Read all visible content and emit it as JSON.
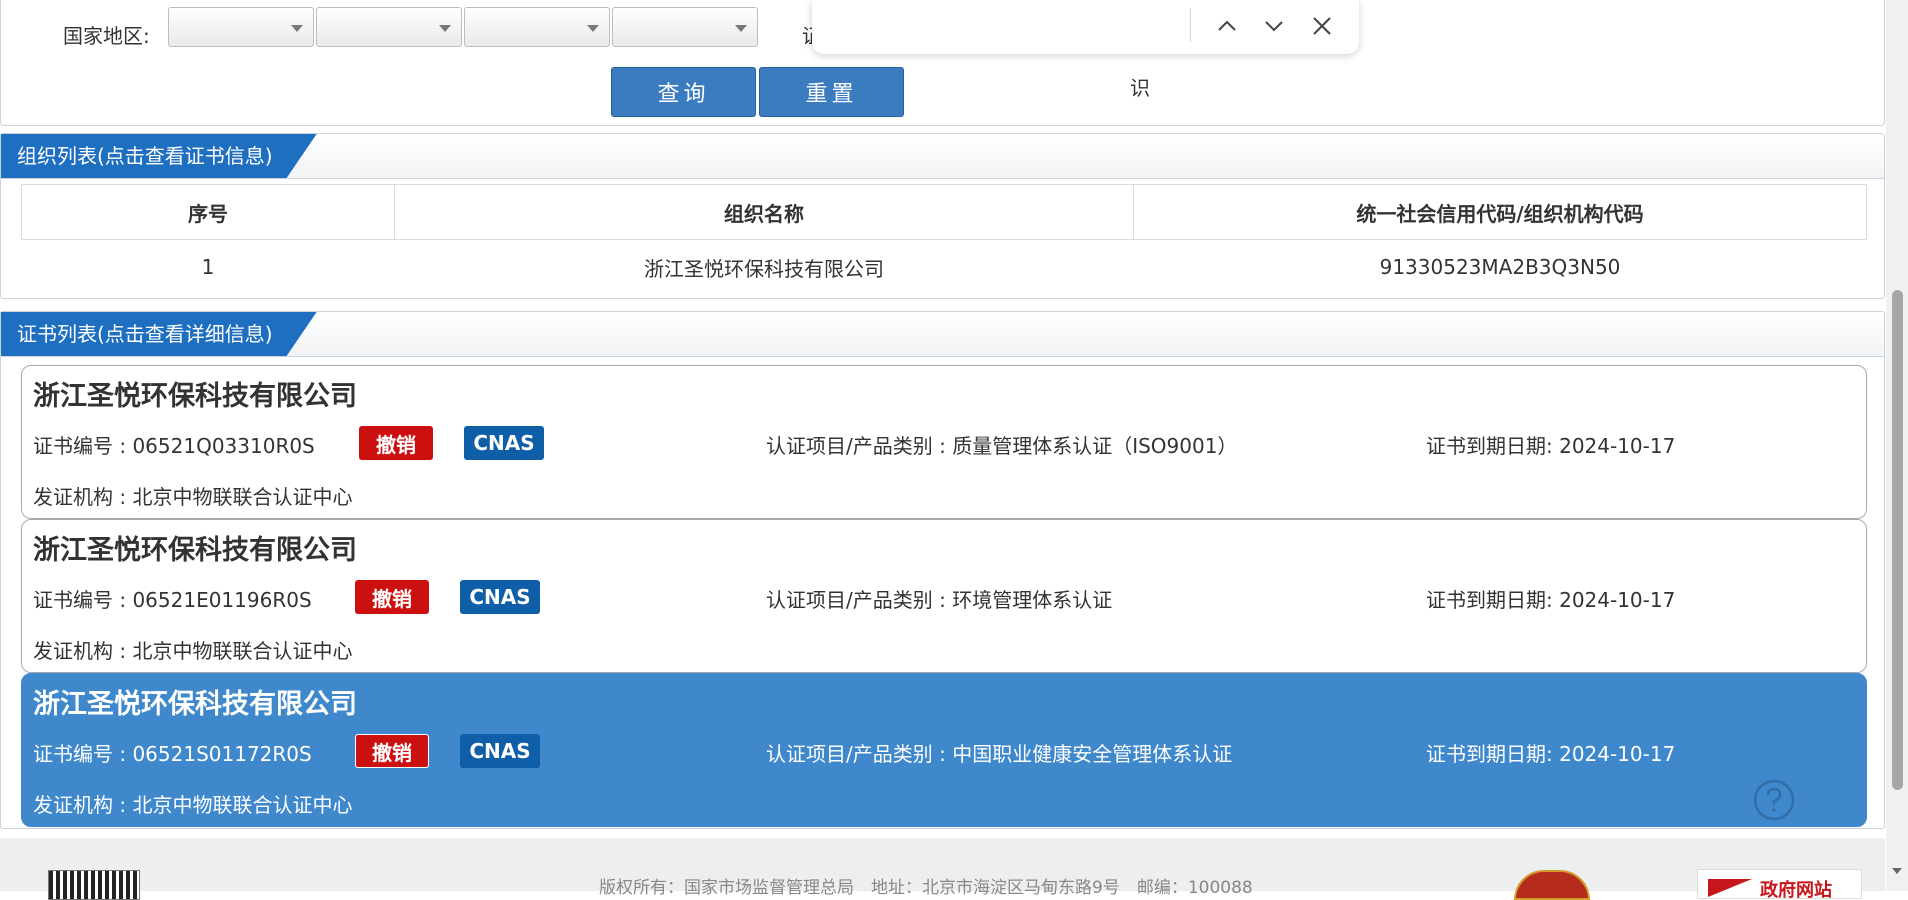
{
  "search": {
    "region_label": "国家地区:",
    "query_button": "查询",
    "reset_button": "重置",
    "stray_char_1": "证",
    "stray_char_2": "识"
  },
  "org_section": {
    "title": "组织列表(点击查看证书信息)",
    "columns": [
      "序号",
      "组织名称",
      "统一社会信用代码/组织机构代码"
    ],
    "rows": [
      {
        "index": "1",
        "name": "浙江圣悦环保科技有限公司",
        "code": "91330523MA2B3Q3N50"
      }
    ]
  },
  "cert_section": {
    "title": "证书列表(点击查看详细信息)",
    "certificates": [
      {
        "company": "浙江圣悦环保科技有限公司",
        "cert_no": "证书编号 : 06521Q03310R0S",
        "status_badge": "撤销",
        "accreditation_badge": "CNAS",
        "category": "认证项目/产品类别 : 质量管理体系认证（ISO9001）",
        "expiry": "证书到期日期: 2024-10-17",
        "issuer": "发证机构 : 北京中物联联合认证中心"
      },
      {
        "company": "浙江圣悦环保科技有限公司",
        "cert_no": "证书编号 : 06521E01196R0S",
        "status_badge": "撤销",
        "accreditation_badge": "CNAS",
        "category": "认证项目/产品类别 : 环境管理体系认证",
        "expiry": "证书到期日期: 2024-10-17",
        "issuer": "发证机构 : 北京中物联联合认证中心"
      },
      {
        "company": "浙江圣悦环保科技有限公司",
        "cert_no": "证书编号 : 06521S01172R0S",
        "status_badge": "撤销",
        "accreditation_badge": "CNAS",
        "category": "认证项目/产品类别 : 中国职业健康安全管理体系认证",
        "expiry": "证书到期日期: 2024-10-17",
        "issuer": "发证机构 : 北京中物联联合认证中心"
      }
    ]
  },
  "footer": {
    "copyright": "版权所有：国家市场监督管理总局　地址：北京市海淀区马甸东路9号　邮编：100088",
    "gov_logo_text": "政府网站"
  },
  "colors": {
    "primary_blue": "#1f6fc1",
    "button_blue": "#3b7cc0",
    "active_card": "#3e88cb",
    "revoked_red": "#cc1010",
    "cnas_blue": "#0f5ea8"
  },
  "icons": {
    "find_prev": "chevron-up-icon",
    "find_next": "chevron-down-icon",
    "find_close": "close-icon",
    "help": "question-circle-icon"
  }
}
